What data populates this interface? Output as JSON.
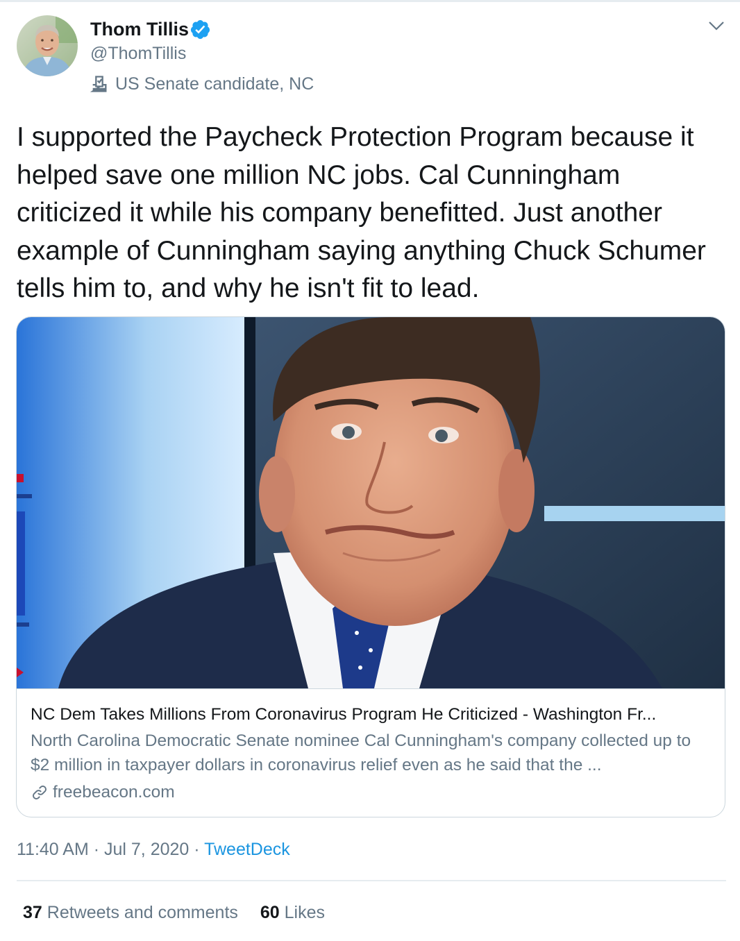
{
  "author": {
    "name": "Thom Tillis",
    "handle": "@ThomTillis",
    "label": "US Senate candidate, NC",
    "verified": true,
    "avatar_icon": "avatar-photo",
    "label_icon": "ballot-box-icon"
  },
  "tweet": {
    "text": "I supported the Paycheck Protection Program because it helped save one million NC jobs. Cal Cunningham criticized it while his company benefitted. Just another example of Cunningham saying anything Chuck Schumer tells him to, and why he isn't fit to lead."
  },
  "card": {
    "title": "NC Dem Takes Millions From Coronavirus Program He Criticized - Washington Fr...",
    "description": "North Carolina Democratic Senate nominee Cal Cunningham's company collected up to $2 million in taxpayer dollars in coronavirus relief even as he said that the ...",
    "domain": "freebeacon.com",
    "link_icon": "link-icon"
  },
  "meta": {
    "time": "11:40 AM",
    "separator": " · ",
    "date": "Jul 7, 2020",
    "source": "TweetDeck"
  },
  "stats": {
    "retweets_count": "37",
    "retweets_label": "Retweets and comments",
    "likes_count": "60",
    "likes_label": "Likes"
  },
  "colors": {
    "text_primary": "#14171a",
    "text_secondary": "#657786",
    "link": "#1b95e0",
    "verified": "#1da1f2",
    "border": "#ccd6dd"
  }
}
